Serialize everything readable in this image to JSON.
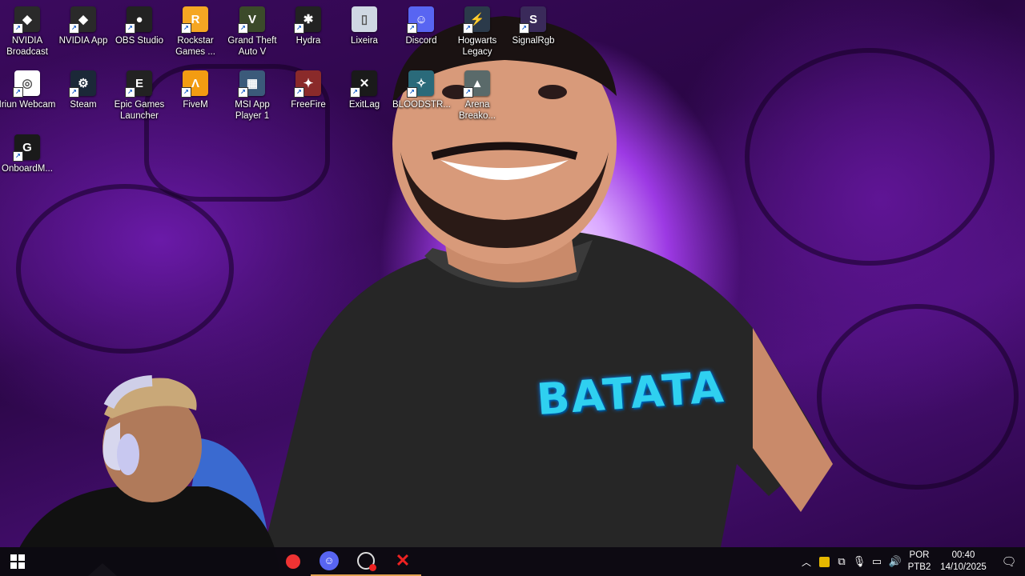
{
  "desktop": {
    "icons": [
      {
        "label": "NVIDIA Broadcast",
        "icon": "nvidia-icon",
        "color": "#2a2a2a",
        "glyph": "◆"
      },
      {
        "label": "NVIDIA App",
        "icon": "nvidia-icon",
        "color": "#2a2a2a",
        "glyph": "◆"
      },
      {
        "label": "OBS Studio",
        "icon": "obs-icon",
        "color": "#222222",
        "glyph": "●"
      },
      {
        "label": "Rockstar Games ...",
        "icon": "rockstar-icon",
        "color": "#f5a623",
        "glyph": "R"
      },
      {
        "label": "Grand Theft Auto V",
        "icon": "gta-icon",
        "color": "#3b4a2a",
        "glyph": "V"
      },
      {
        "label": "Hydra",
        "icon": "hydra-icon",
        "color": "#222222",
        "glyph": "✱"
      },
      {
        "label": "Lixeira",
        "icon": "recycle-bin-icon",
        "color": "#cfd8e3",
        "glyph": "▯"
      },
      {
        "label": "Discord",
        "icon": "discord-icon",
        "color": "#5865f2",
        "glyph": "☺"
      },
      {
        "label": "Hogwarts Legacy",
        "icon": "hogwarts-icon",
        "color": "#2b3a4a",
        "glyph": "⚡"
      },
      {
        "label": "SignalRgb",
        "icon": "signalrgb-icon",
        "color": "#3a2a5a",
        "glyph": "S"
      },
      {
        "label": "Iriun Webcam",
        "icon": "iriun-icon",
        "color": "#ffffff",
        "glyph": "◎"
      },
      {
        "label": "Steam",
        "icon": "steam-icon",
        "color": "#1b2838",
        "glyph": "⚙"
      },
      {
        "label": "Epic Games Launcher",
        "icon": "epic-icon",
        "color": "#222222",
        "glyph": "E"
      },
      {
        "label": "FiveM",
        "icon": "fivem-icon",
        "color": "#f39c12",
        "glyph": "Λ"
      },
      {
        "label": "MSI App Player 1",
        "icon": "msi-icon",
        "color": "#3b5a7a",
        "glyph": "▦"
      },
      {
        "label": "FreeFire",
        "icon": "freefire-icon",
        "color": "#8a2a2a",
        "glyph": "✦"
      },
      {
        "label": "ExitLag",
        "icon": "exitlag-icon",
        "color": "#1a1a1a",
        "glyph": "✕"
      },
      {
        "label": "BLOODSTR...",
        "icon": "bloodstrike-icon",
        "color": "#2a6a7a",
        "glyph": "✧"
      },
      {
        "label": "Arena Breako...",
        "icon": "arena-icon",
        "color": "#5a6a6a",
        "glyph": "▲"
      },
      {
        "label": "OnboardM...",
        "icon": "logitech-icon",
        "color": "#1a1a1a",
        "glyph": "G"
      }
    ],
    "wallpaper_text": "BATATA"
  },
  "taskbar": {
    "pinned": [
      {
        "name": "start",
        "icon": "windows-start-icon"
      },
      {
        "name": "chrome",
        "icon": "app-red-icon"
      },
      {
        "name": "discord",
        "icon": "discord-icon"
      },
      {
        "name": "obs",
        "icon": "obs-recording-icon"
      },
      {
        "name": "exitlag",
        "icon": "exitlag-icon"
      }
    ],
    "tray": {
      "language_top": "POR",
      "language_bottom": "PTB2",
      "time": "00:40",
      "date": "14/10/2025"
    }
  }
}
